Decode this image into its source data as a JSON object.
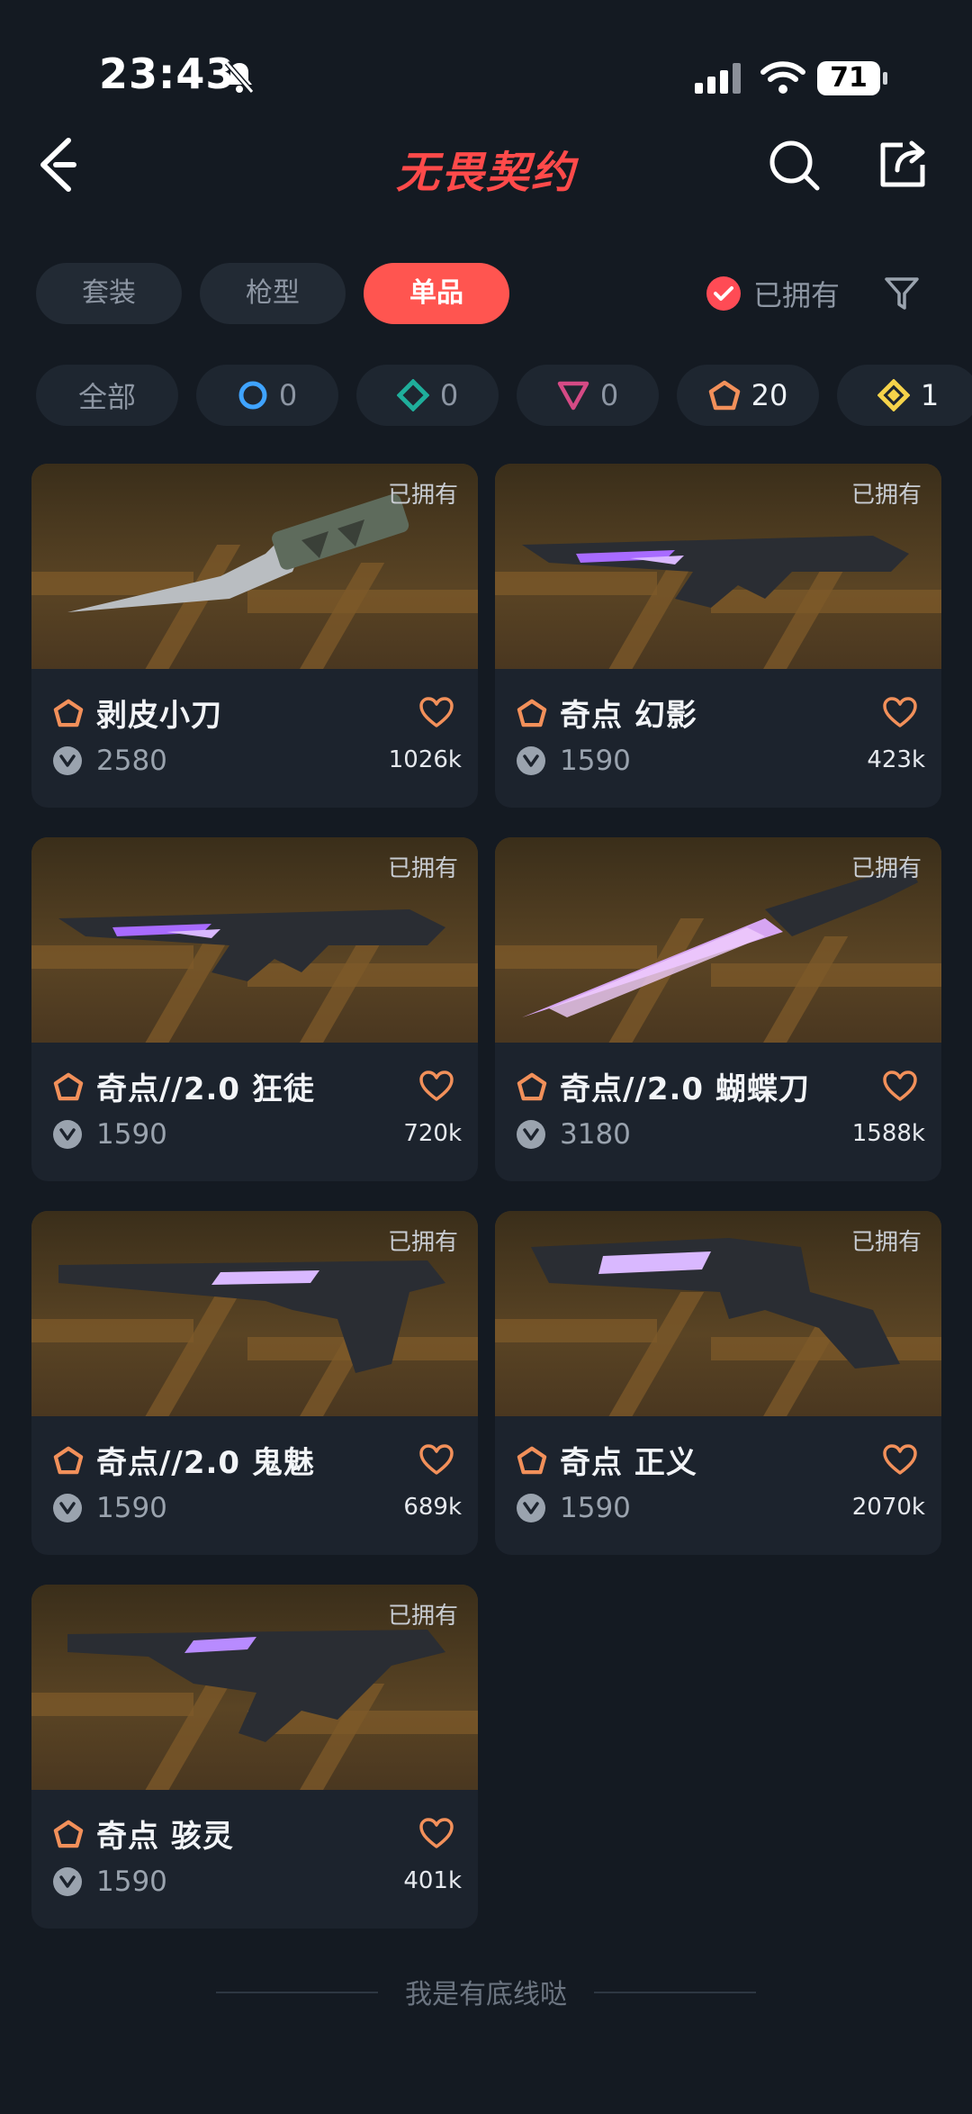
{
  "status_bar": {
    "time": "23:43",
    "battery": "71"
  },
  "header": {
    "title": "无畏契约"
  },
  "tabs": [
    {
      "label": "套装",
      "active": false
    },
    {
      "label": "枪型",
      "active": false
    },
    {
      "label": "单品",
      "active": true
    }
  ],
  "owned_filter": {
    "label": "已拥有",
    "checked": true
  },
  "rarity_chips": [
    {
      "label": "全部",
      "icon": "all"
    },
    {
      "icon": "ring-blue",
      "count": "0",
      "color": "#3fa3ff"
    },
    {
      "icon": "diamond-teal",
      "count": "0",
      "color": "#1fae9b"
    },
    {
      "icon": "triangle-pink",
      "count": "0",
      "color": "#d54a85"
    },
    {
      "icon": "pentagon-orange",
      "count": "20",
      "color": "#f2905a"
    },
    {
      "icon": "diamond-yellow",
      "count": "1",
      "color": "#f5d34a"
    }
  ],
  "items": [
    {
      "name": "剥皮小刀",
      "price": "2580",
      "likes": "1026k",
      "owned_tag": "已拥有",
      "weapon": "knife"
    },
    {
      "name": "奇点 幻影",
      "price": "1590",
      "likes": "423k",
      "owned_tag": "已拥有",
      "weapon": "rifle"
    },
    {
      "name": "奇点//2.0 狂徒",
      "price": "1590",
      "likes": "720k",
      "owned_tag": "已拥有",
      "weapon": "rifle"
    },
    {
      "name": "奇点//2.0 蝴蝶刀",
      "price": "3180",
      "likes": "1588k",
      "owned_tag": "已拥有",
      "weapon": "blade"
    },
    {
      "name": "奇点//2.0 鬼魅",
      "price": "1590",
      "likes": "689k",
      "owned_tag": "已拥有",
      "weapon": "pistol"
    },
    {
      "name": "奇点 正义",
      "price": "1590",
      "likes": "2070k",
      "owned_tag": "已拥有",
      "weapon": "revolver"
    },
    {
      "name": "奇点 骇灵",
      "price": "1590",
      "likes": "401k",
      "owned_tag": "已拥有",
      "weapon": "smg"
    }
  ],
  "footer": {
    "text": "我是有底线哒"
  }
}
